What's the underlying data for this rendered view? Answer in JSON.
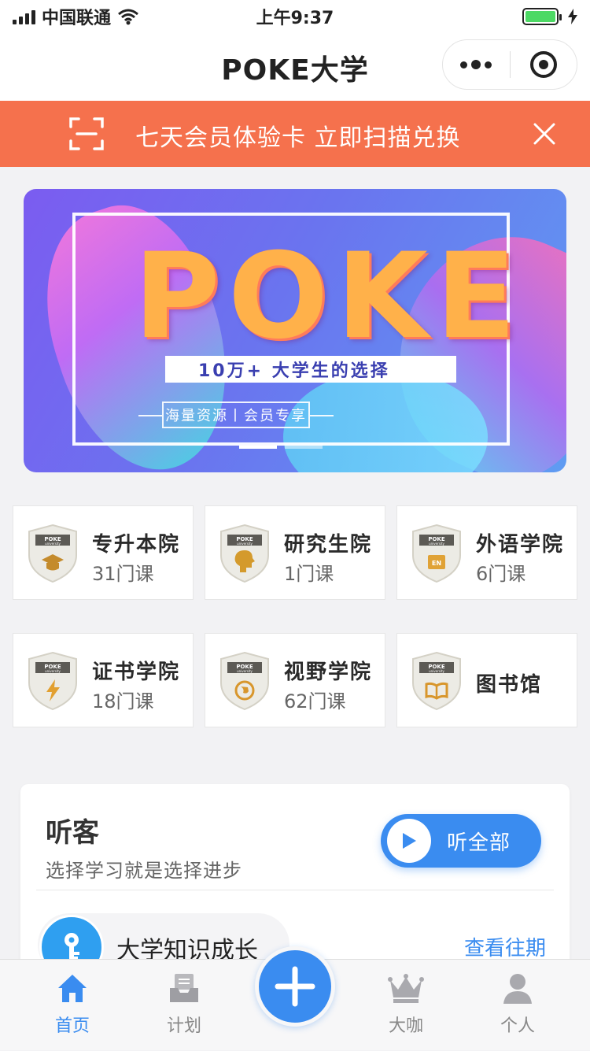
{
  "status_bar": {
    "carrier": "中国联通",
    "time": "上午9:37",
    "battery_level": 1.0
  },
  "header": {
    "title": "POKE大学",
    "more_icon": "more-dots-icon",
    "close_icon": "target-circle-icon"
  },
  "promo": {
    "text": "七天会员体验卡  立即扫描兑换",
    "icon": "scan-icon",
    "close_icon": "close-icon",
    "color": "#f5714d"
  },
  "hero": {
    "brand": "POKE",
    "tagline": "10万+  大学生的选择",
    "sub": "海量资源丨会员专享"
  },
  "categories": [
    {
      "name": "专升本院",
      "count": "31门课",
      "icon": "graduation-cap-icon"
    },
    {
      "name": "研究生院",
      "count": "1门课",
      "icon": "head-icon"
    },
    {
      "name": "外语学院",
      "count": "6门课",
      "icon": "en-book-icon"
    },
    {
      "name": "证书学院",
      "count": "18门课",
      "icon": "lightning-icon"
    },
    {
      "name": "视野学院",
      "count": "62门课",
      "icon": "globe-icon"
    },
    {
      "name": "图书馆",
      "count": "",
      "icon": "open-book-icon"
    }
  ],
  "shield_label": "POKE",
  "shield_sub": "university",
  "listen": {
    "title": "听客",
    "subtitle": "选择学习就是选择进步",
    "play_all": "听全部",
    "series_title": "大学知识成长",
    "history_link": "查看往期"
  },
  "tabs": [
    {
      "label": "首页",
      "icon": "home-icon",
      "active": true
    },
    {
      "label": "计划",
      "icon": "inbox-icon",
      "active": false
    },
    {
      "label": "大咖",
      "icon": "crown-icon",
      "active": false
    },
    {
      "label": "个人",
      "icon": "person-icon",
      "active": false
    }
  ],
  "colors": {
    "accent": "#3a8cf0",
    "promo": "#f5714d",
    "battery": "#4cd964"
  }
}
